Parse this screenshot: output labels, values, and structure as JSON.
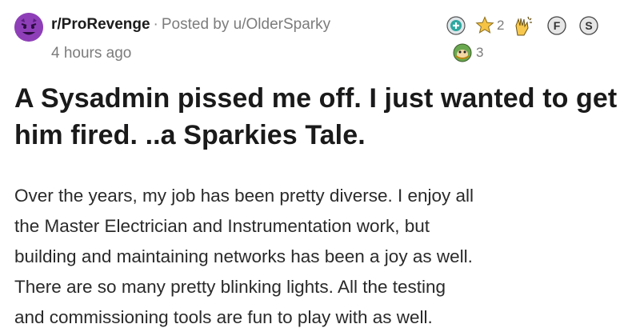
{
  "post": {
    "subreddit": "r/ProRevenge",
    "separator": "·",
    "posted_by": "Posted by u/OlderSparky",
    "time": "4 hours ago",
    "title": "A Sysadmin pissed me off. I just wanted to get him fired. ..a Sparkies Tale.",
    "body": "Over the years, my job has been pretty diverse. I enjoy all\nthe Master Electrician and Instrumentation work, but\nbuilding and maintaining networks has been a joy as well.\nThere are so many pretty blinking lights. All the testing\nand commissioning tools are fun to play with as well."
  },
  "awards": [
    {
      "icon": "plus-badge-award-icon",
      "count": ""
    },
    {
      "icon": "star-award-icon",
      "count": "2"
    },
    {
      "icon": "clapping-hands-award-icon",
      "count": ""
    },
    {
      "icon": "f-award-icon",
      "label": "F",
      "count": ""
    },
    {
      "icon": "s-award-icon",
      "label": "S",
      "count": ""
    },
    {
      "icon": "monkey-award-icon",
      "count": "3"
    }
  ],
  "colors": {
    "avatar_bg": "#8e3fb8",
    "meta_gray": "#7c7c7c",
    "title": "#1a1a1b"
  }
}
